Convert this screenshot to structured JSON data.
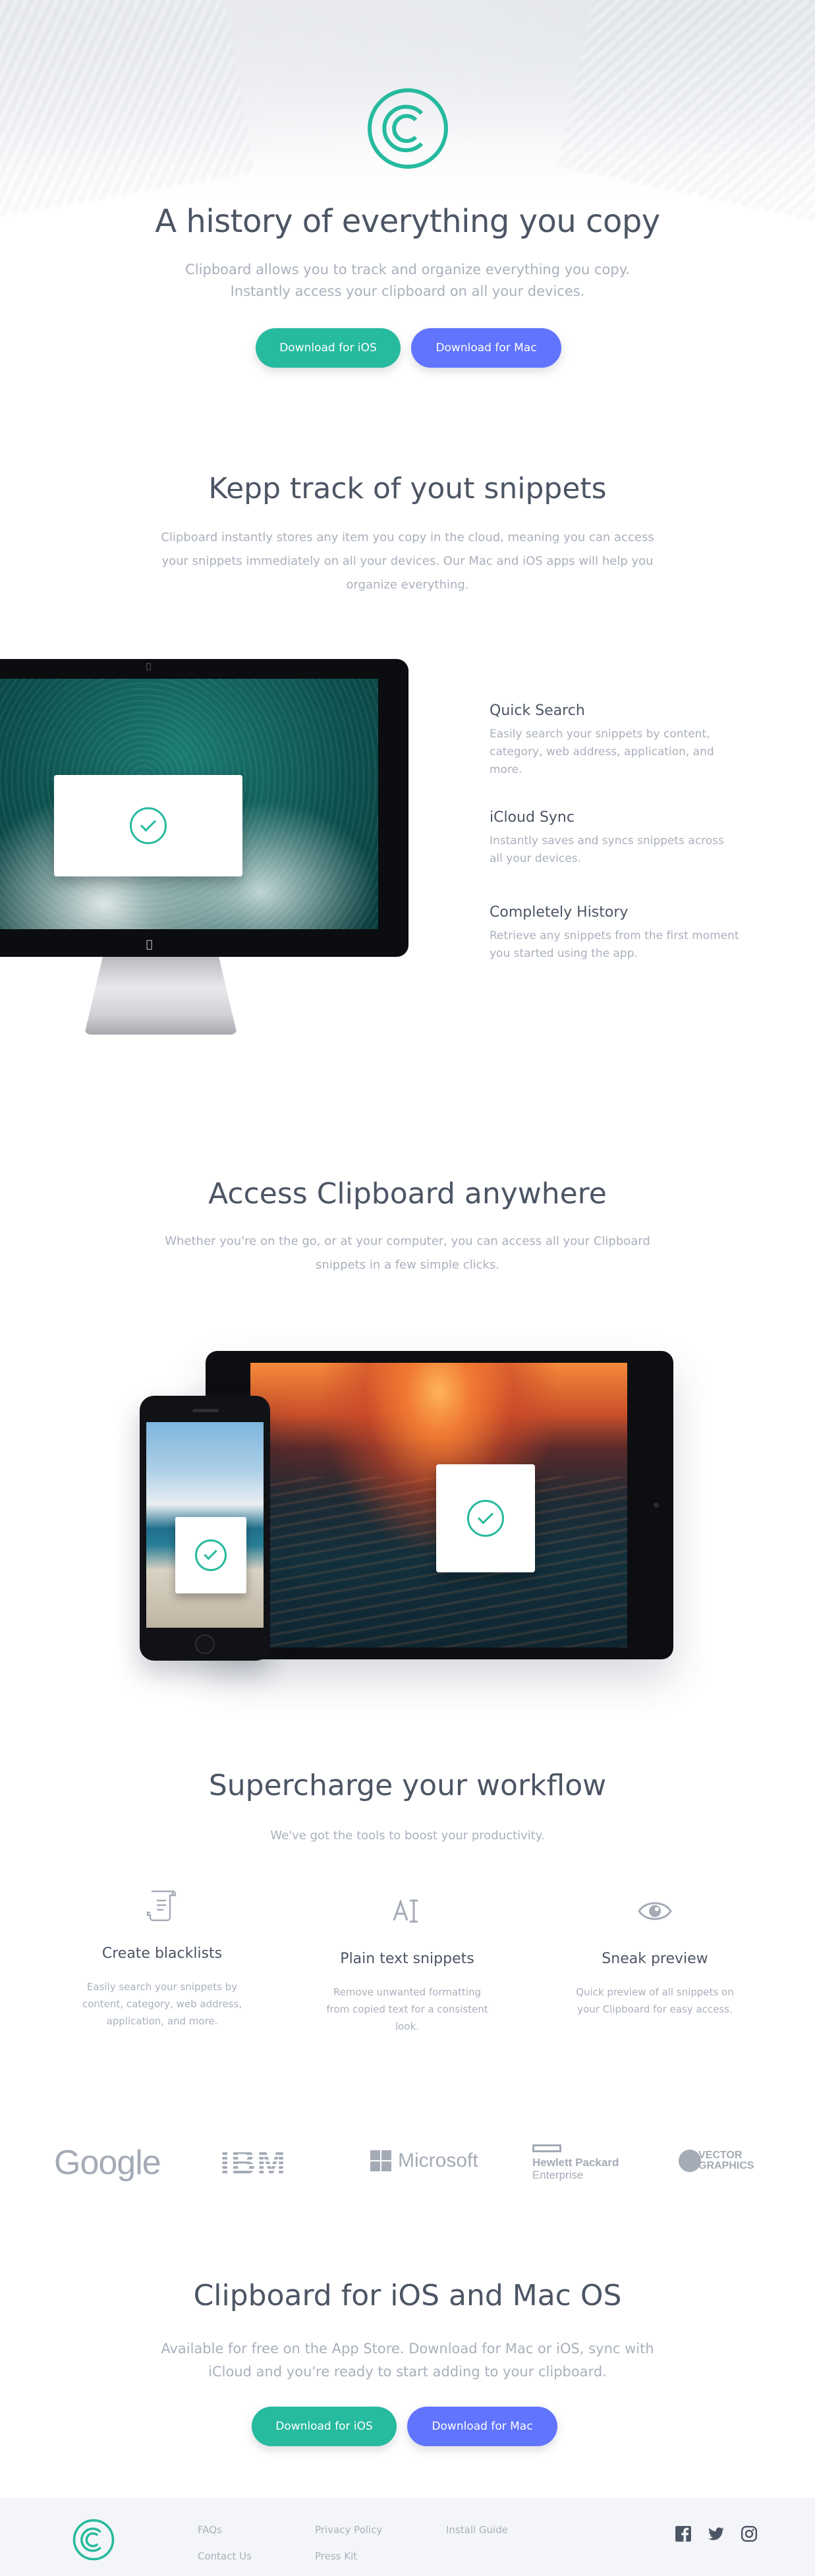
{
  "hero": {
    "title": "A history of everything you copy",
    "subtitle_line1": "Clipboard allows you to track and organize everything you copy.",
    "subtitle_line2": "Instantly access your clipboard on all your devices.",
    "btn_ios": "Download for iOS",
    "btn_mac": "Download for Mac"
  },
  "snippets": {
    "title": "Kepp track of yout snippets",
    "subtitle": "Clipboard instantly stores any item you copy in the cloud, meaning you can access your snippets immediately on all your devices. Our Mac and iOS apps will help you organize everything.",
    "features": [
      {
        "title": "Quick Search",
        "desc": "Easily search your snippets by content, category, web address, application, and more."
      },
      {
        "title": "iCloud Sync",
        "desc": "Instantly saves and syncs snippets across all your devices."
      },
      {
        "title": "Completely History",
        "desc": "Retrieve any snippets from the first moment you started using the app."
      }
    ]
  },
  "access": {
    "title": "Access Clipboard anywhere",
    "subtitle": "Whether you're on the go, or at your computer, you can access all your Clipboard snippets in a few simple clicks."
  },
  "workflow": {
    "title": "Supercharge your workflow",
    "subtitle": "We've got the tools to boost your productivity.",
    "tools": [
      {
        "title": "Create blacklists",
        "desc": "Easily search your snippets by content, category, web address, application, and more.",
        "icon": "blacklist-icon"
      },
      {
        "title": "Plain text snippets",
        "desc": "Remove unwanted formatting from copied text for a consistent look.",
        "icon": "text-icon"
      },
      {
        "title": "Sneak preview",
        "desc": "Quick preview of all snippets on your Clipboard for easy access.",
        "icon": "eye-icon"
      }
    ]
  },
  "logos": {
    "google": "Google",
    "ibm": "IBM",
    "microsoft": "Microsoft",
    "hp_line1": "Hewlett Packard",
    "hp_line2": "Enterprise",
    "vector_line1": "VECTOR",
    "vector_line2": "GRAPHICS"
  },
  "cta": {
    "title": "Clipboard for iOS and Mac OS",
    "subtitle": "Available for free on the App Store. Download for Mac or iOS, sync with iCloud and you're ready to start adding to your clipboard.",
    "btn_ios": "Download for iOS",
    "btn_mac": "Download for Mac"
  },
  "footer": {
    "links": [
      "FAQs",
      "Contact Us",
      "Privacy Policy",
      "Press Kit",
      "Install Guide"
    ],
    "social": [
      "facebook-icon",
      "twitter-icon",
      "instagram-icon"
    ]
  },
  "colors": {
    "teal": "#26ba9e",
    "blue": "#6174fd",
    "heading": "#4c5564",
    "muted": "#a9b0bc",
    "footer_bg": "#f4f5f8"
  }
}
